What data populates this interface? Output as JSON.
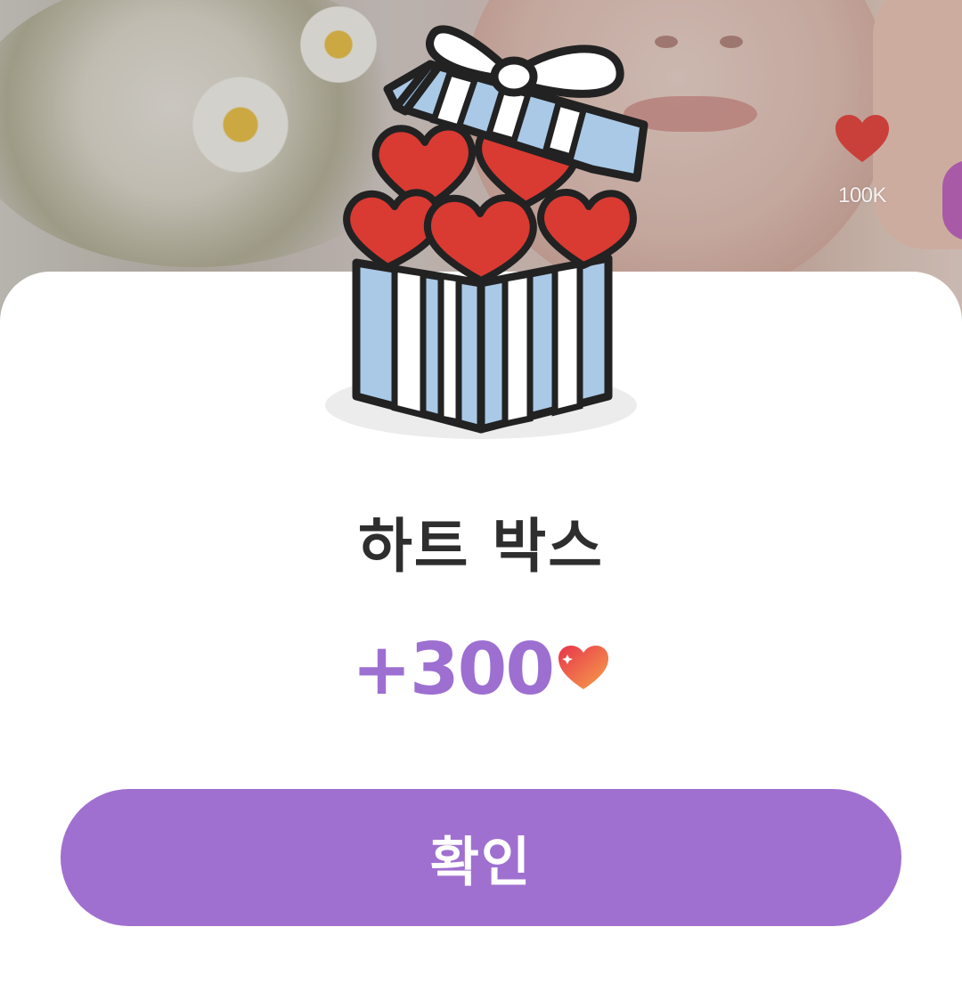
{
  "background": {
    "side_like_icon": "heart-icon",
    "side_like_count": "100K"
  },
  "dialog": {
    "illustration": "gift-box-with-hearts",
    "title": "하트 박스",
    "reward_amount": "+300",
    "reward_icon": "heart-icon",
    "confirm_label": "확인"
  },
  "colors": {
    "accent": "#a070d0",
    "amount_text": "#9d6fd1",
    "title_text": "#2e2e2e",
    "heart_red": "#d93a32",
    "box_blue": "#a9c9e6"
  }
}
